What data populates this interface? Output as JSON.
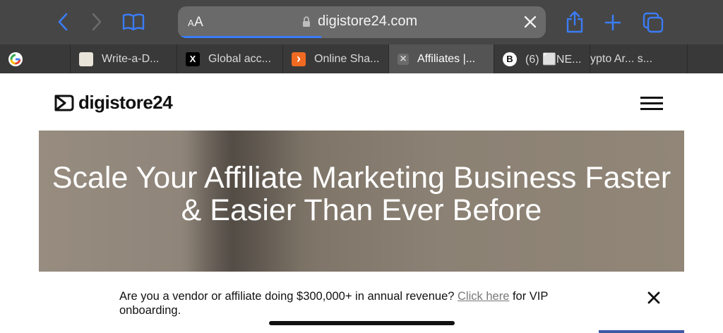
{
  "browser": {
    "text_size_label": "AA",
    "url": "digistore24.com",
    "tabs": [
      {
        "favicon": "G",
        "favicon_bg": "#ffffff",
        "favicon_color": "#4285f4",
        "label": ""
      },
      {
        "favicon": "",
        "favicon_bg": "#e9e4d8",
        "favicon_color": "#555555",
        "label": "Write-a-D..."
      },
      {
        "favicon": "X",
        "favicon_bg": "#000000",
        "favicon_color": "#ffffff",
        "label": "Global acc..."
      },
      {
        "favicon": "›",
        "favicon_bg": "#f06a22",
        "favicon_color": "#ffffff",
        "label": "Online Sha..."
      },
      {
        "favicon": "×",
        "favicon_bg": "#6b6b6b",
        "favicon_color": "#cfcfcf",
        "label": "Affiliates |..."
      },
      {
        "favicon": "B",
        "favicon_bg": "#ffffff",
        "favicon_color": "#111111",
        "label": "(6) ⬜NE..."
      },
      {
        "favicon": "",
        "favicon_bg": "transparent",
        "favicon_color": "#d9d9d9",
        "label": "ypto Ar...  s..."
      }
    ]
  },
  "site": {
    "logo_text": "digistore24",
    "hero_title": "Scale Your Affiliate Marketing Business Faster & Easier Than Ever Before"
  },
  "banner": {
    "text_before": "Are you a vendor or affiliate doing $300,000+ in annual revenue? ",
    "link_text": "Click here",
    "text_after": " for VIP onboarding."
  },
  "colors": {
    "accent": "#3b7cf6",
    "toolbar_bg": "#464646",
    "tabbar_bg": "#393939"
  }
}
